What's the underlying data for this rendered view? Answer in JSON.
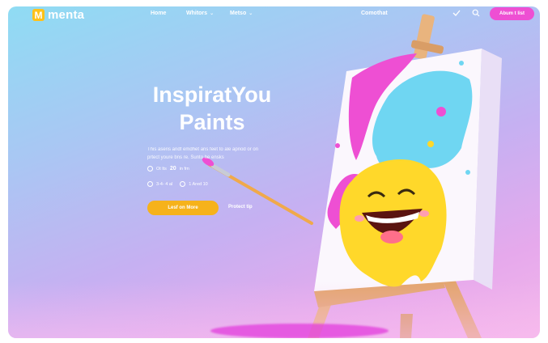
{
  "brand": {
    "logo_letter": "M",
    "name": "menta"
  },
  "nav": {
    "links": [
      {
        "label": "Home",
        "has_caret": false
      },
      {
        "label": "Whitors",
        "has_caret": true
      },
      {
        "label": "Metso",
        "has_caret": true
      },
      {
        "label": "Comothat",
        "has_caret": false
      }
    ],
    "icons": [
      "check-icon",
      "search-icon"
    ],
    "cta_label": "Abum t list"
  },
  "hero": {
    "title_line1": "InspiratYou",
    "title_line2": "Paints",
    "description": "This aseris andf emdhet ans feet to ale apriod or on prtect youre bns re. Sunto he ensks",
    "meta1_prefix": "Ot lts",
    "meta1_value": "20",
    "meta1_suffix": "in frn",
    "meta2_a": "3-4- 4 al",
    "meta2_b": "1 Ared 10",
    "primary_button": "Lesf on More",
    "secondary_link": "Protect tip"
  },
  "colors": {
    "accent_pink": "#ee4fd3",
    "accent_yellow": "#f6b21b",
    "logo_yellow": "#ffc21a"
  }
}
